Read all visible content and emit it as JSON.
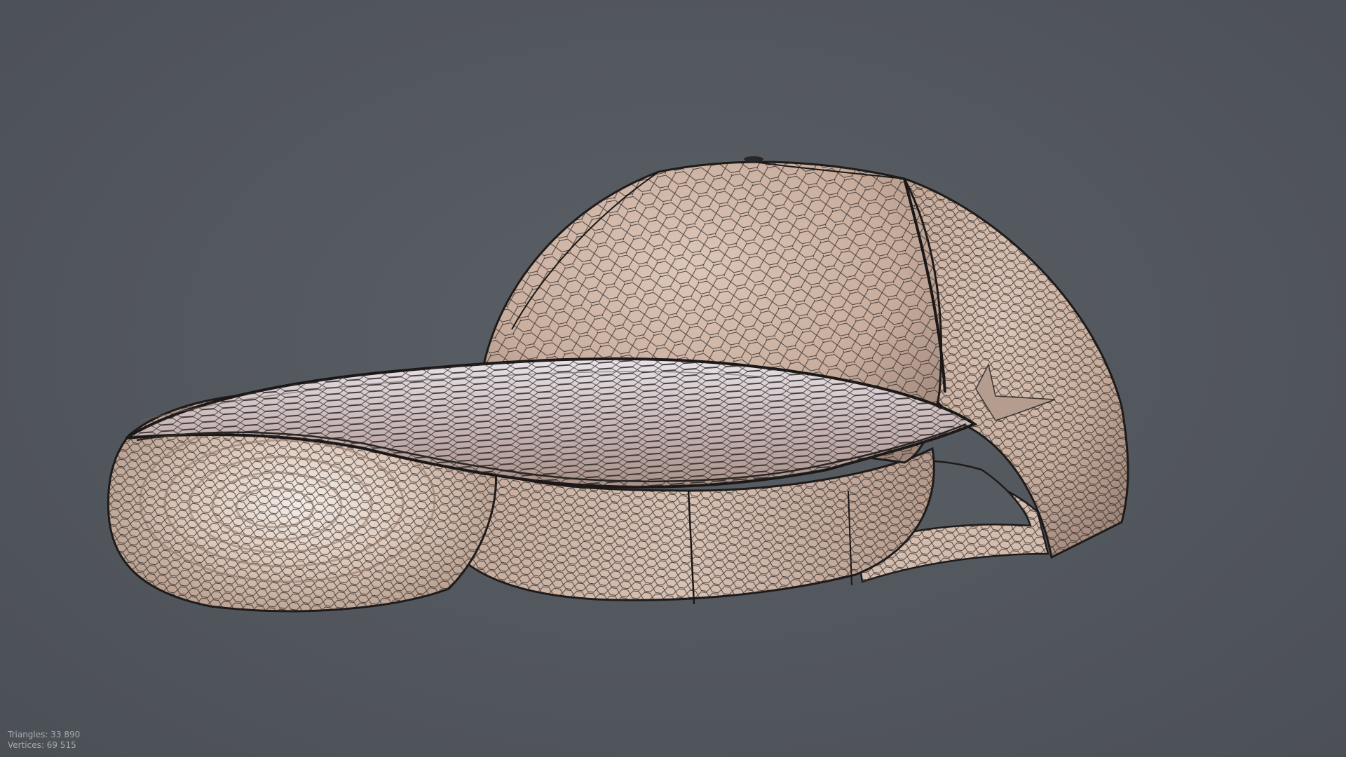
{
  "viewport": {
    "background": "#52575d",
    "model": {
      "subject": "baseball cap",
      "render_mode": "shaded-wireframe",
      "surface_color": "#cdb3a3",
      "wire_color": "#1e1b1a"
    }
  },
  "stats": {
    "triangles": "Triangles: 33 890",
    "vertices": "Vertices: 69 515"
  }
}
